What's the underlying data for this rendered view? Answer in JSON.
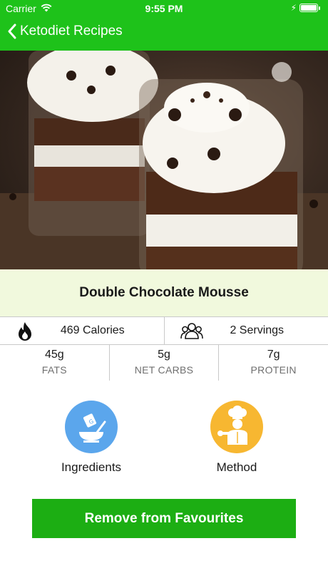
{
  "status_bar": {
    "carrier": "Carrier",
    "time": "9:55 PM"
  },
  "nav": {
    "back_label": "Ketodiet Recipes"
  },
  "recipe": {
    "title": "Double Chocolate Mousse",
    "calories": "469 Calories",
    "servings": "2 Servings",
    "macros": [
      {
        "value": "45g",
        "label": "FATS"
      },
      {
        "value": "5g",
        "label": "NET CARBS"
      },
      {
        "value": "7g",
        "label": "PROTEIN"
      }
    ]
  },
  "actions": {
    "ingredients_label": "Ingredients",
    "method_label": "Method"
  },
  "buttons": {
    "favourite_label": "Remove from Favourites"
  },
  "colors": {
    "brand_green": "#1ec21a",
    "button_green": "#1cae13",
    "title_band": "#f1f9dd",
    "ingredients_circle": "#5ba6ec",
    "method_circle": "#f7b731"
  },
  "icons": {
    "back": "chevron-left-icon",
    "wifi": "wifi-icon",
    "battery": "battery-icon",
    "calories": "flame-icon",
    "servings": "people-icon",
    "ingredients": "mixing-bowl-icon",
    "method": "chef-icon"
  }
}
